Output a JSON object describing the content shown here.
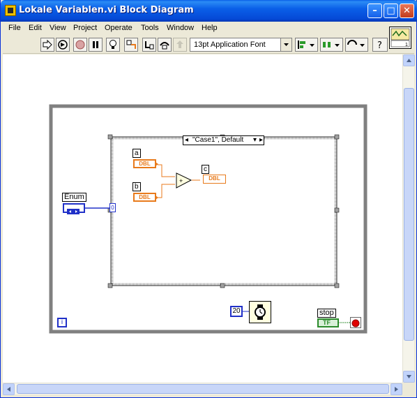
{
  "window": {
    "title": "Lokale Variablen.vi Block Diagram"
  },
  "menu": [
    "File",
    "Edit",
    "View",
    "Project",
    "Operate",
    "Tools",
    "Window",
    "Help"
  ],
  "toolbar": {
    "font": "13pt Application Font"
  },
  "diagram": {
    "case_selector": "\"Case1\", Default",
    "enum_label": "Enum",
    "a_label": "a",
    "b_label": "b",
    "c_label": "c",
    "dbl_text": "DBL",
    "add_symbol": "+",
    "wait_constant": "20",
    "stop_label": "stop",
    "tf_text": "TF",
    "iteration_symbol": "i",
    "case_index": "0"
  },
  "colors": {
    "orange_wire": "#e87a1b",
    "blue_wire": "#2030c8",
    "green_wire": "#2b8a2b",
    "loop_frame": "#808080"
  }
}
